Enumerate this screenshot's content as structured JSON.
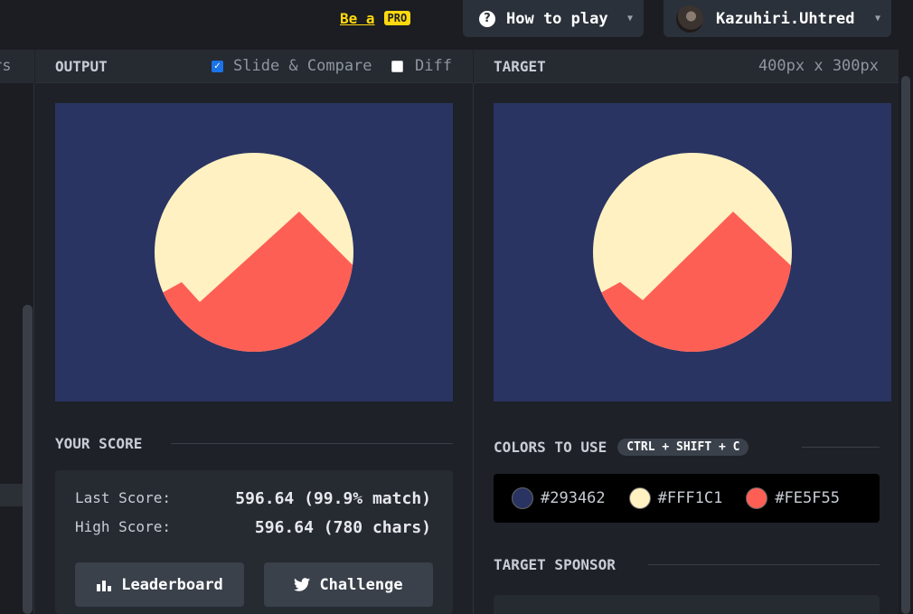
{
  "topbar": {
    "be_a_label": "Be a",
    "pro_badge": "PRO",
    "how_to_play": "How to play",
    "username": "Kazuhiri.Uhtred"
  },
  "left_panel": {
    "partial_title": "rs"
  },
  "output": {
    "title": "OUTPUT",
    "slide_compare_label": "Slide & Compare",
    "slide_compare_checked": true,
    "diff_label": "Diff",
    "diff_checked": false
  },
  "target": {
    "title": "TARGET",
    "dimensions": "400px x 300px"
  },
  "score": {
    "section_title": "YOUR SCORE",
    "last_label": "Last Score:",
    "last_value": "596.64 (99.9% match)",
    "high_label": "High Score:",
    "high_value": "596.64 (780 chars)",
    "leaderboard_label": "Leaderboard",
    "challenge_label": "Challenge"
  },
  "colors": {
    "section_title": "COLORS TO USE",
    "shortcut": "CTRL + SHIFT + C",
    "swatches": [
      {
        "hex": "#293462",
        "color": "#293462"
      },
      {
        "hex": "#FFF1C1",
        "color": "#FFF1C1"
      },
      {
        "hex": "#FE5F55",
        "color": "#FE5F55"
      }
    ]
  },
  "sponsor": {
    "section_title": "TARGET SPONSOR"
  },
  "theme": {
    "background": "#293462",
    "circle": "#FFF1C1",
    "mountain": "#FE5F55",
    "accent": "#FFD90F"
  }
}
